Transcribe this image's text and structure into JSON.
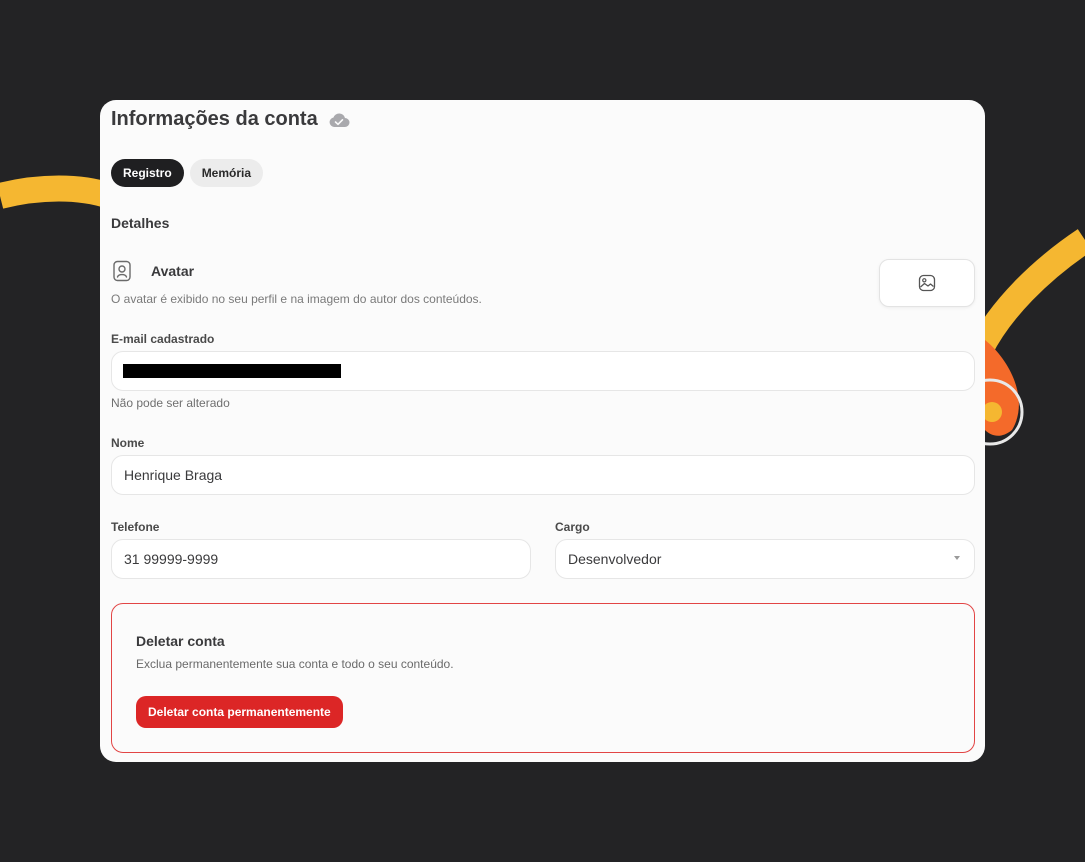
{
  "page": {
    "title": "Informações da conta"
  },
  "tabs": [
    {
      "label": "Registro",
      "active": true
    },
    {
      "label": "Memória",
      "active": false
    }
  ],
  "details": {
    "section_title": "Detalhes",
    "avatar": {
      "label": "Avatar",
      "description": "O avatar é exibido no seu perfil e na imagem do autor dos conteúdos."
    },
    "email": {
      "label": "E-mail cadastrado",
      "hint": "Não pode ser alterado"
    },
    "name": {
      "label": "Nome",
      "value": "Henrique Braga"
    },
    "phone": {
      "label": "Telefone",
      "value": "31 99999-9999"
    },
    "role": {
      "label": "Cargo",
      "value": "Desenvolvedor"
    }
  },
  "danger_zone": {
    "title": "Deletar conta",
    "description": "Exclua permanentemente sua conta e todo o seu conteúdo.",
    "button_label": "Deletar conta permanentemente"
  },
  "icons": {
    "title_status": "cloud-check-icon",
    "avatar": "user-badge-icon",
    "upload": "image-icon",
    "select": "chevron-down-icon"
  },
  "colors": {
    "background": "#232325",
    "card": "#fbfbfb",
    "accent_yellow": "#f5b731",
    "accent_orange": "#f46a2a",
    "danger": "#dc2626",
    "tab_active": "#1f1f21"
  }
}
